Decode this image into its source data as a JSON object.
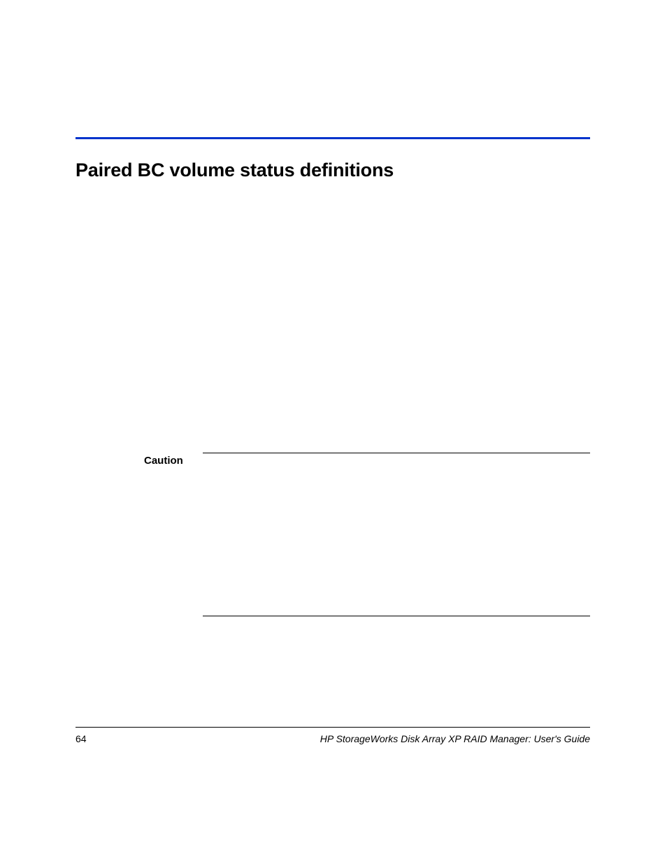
{
  "heading": "Paired BC volume status definitions",
  "caution_label": "Caution",
  "footer": {
    "page_number": "64",
    "title": "HP StorageWorks Disk Array XP RAID Manager: User's Guide"
  }
}
